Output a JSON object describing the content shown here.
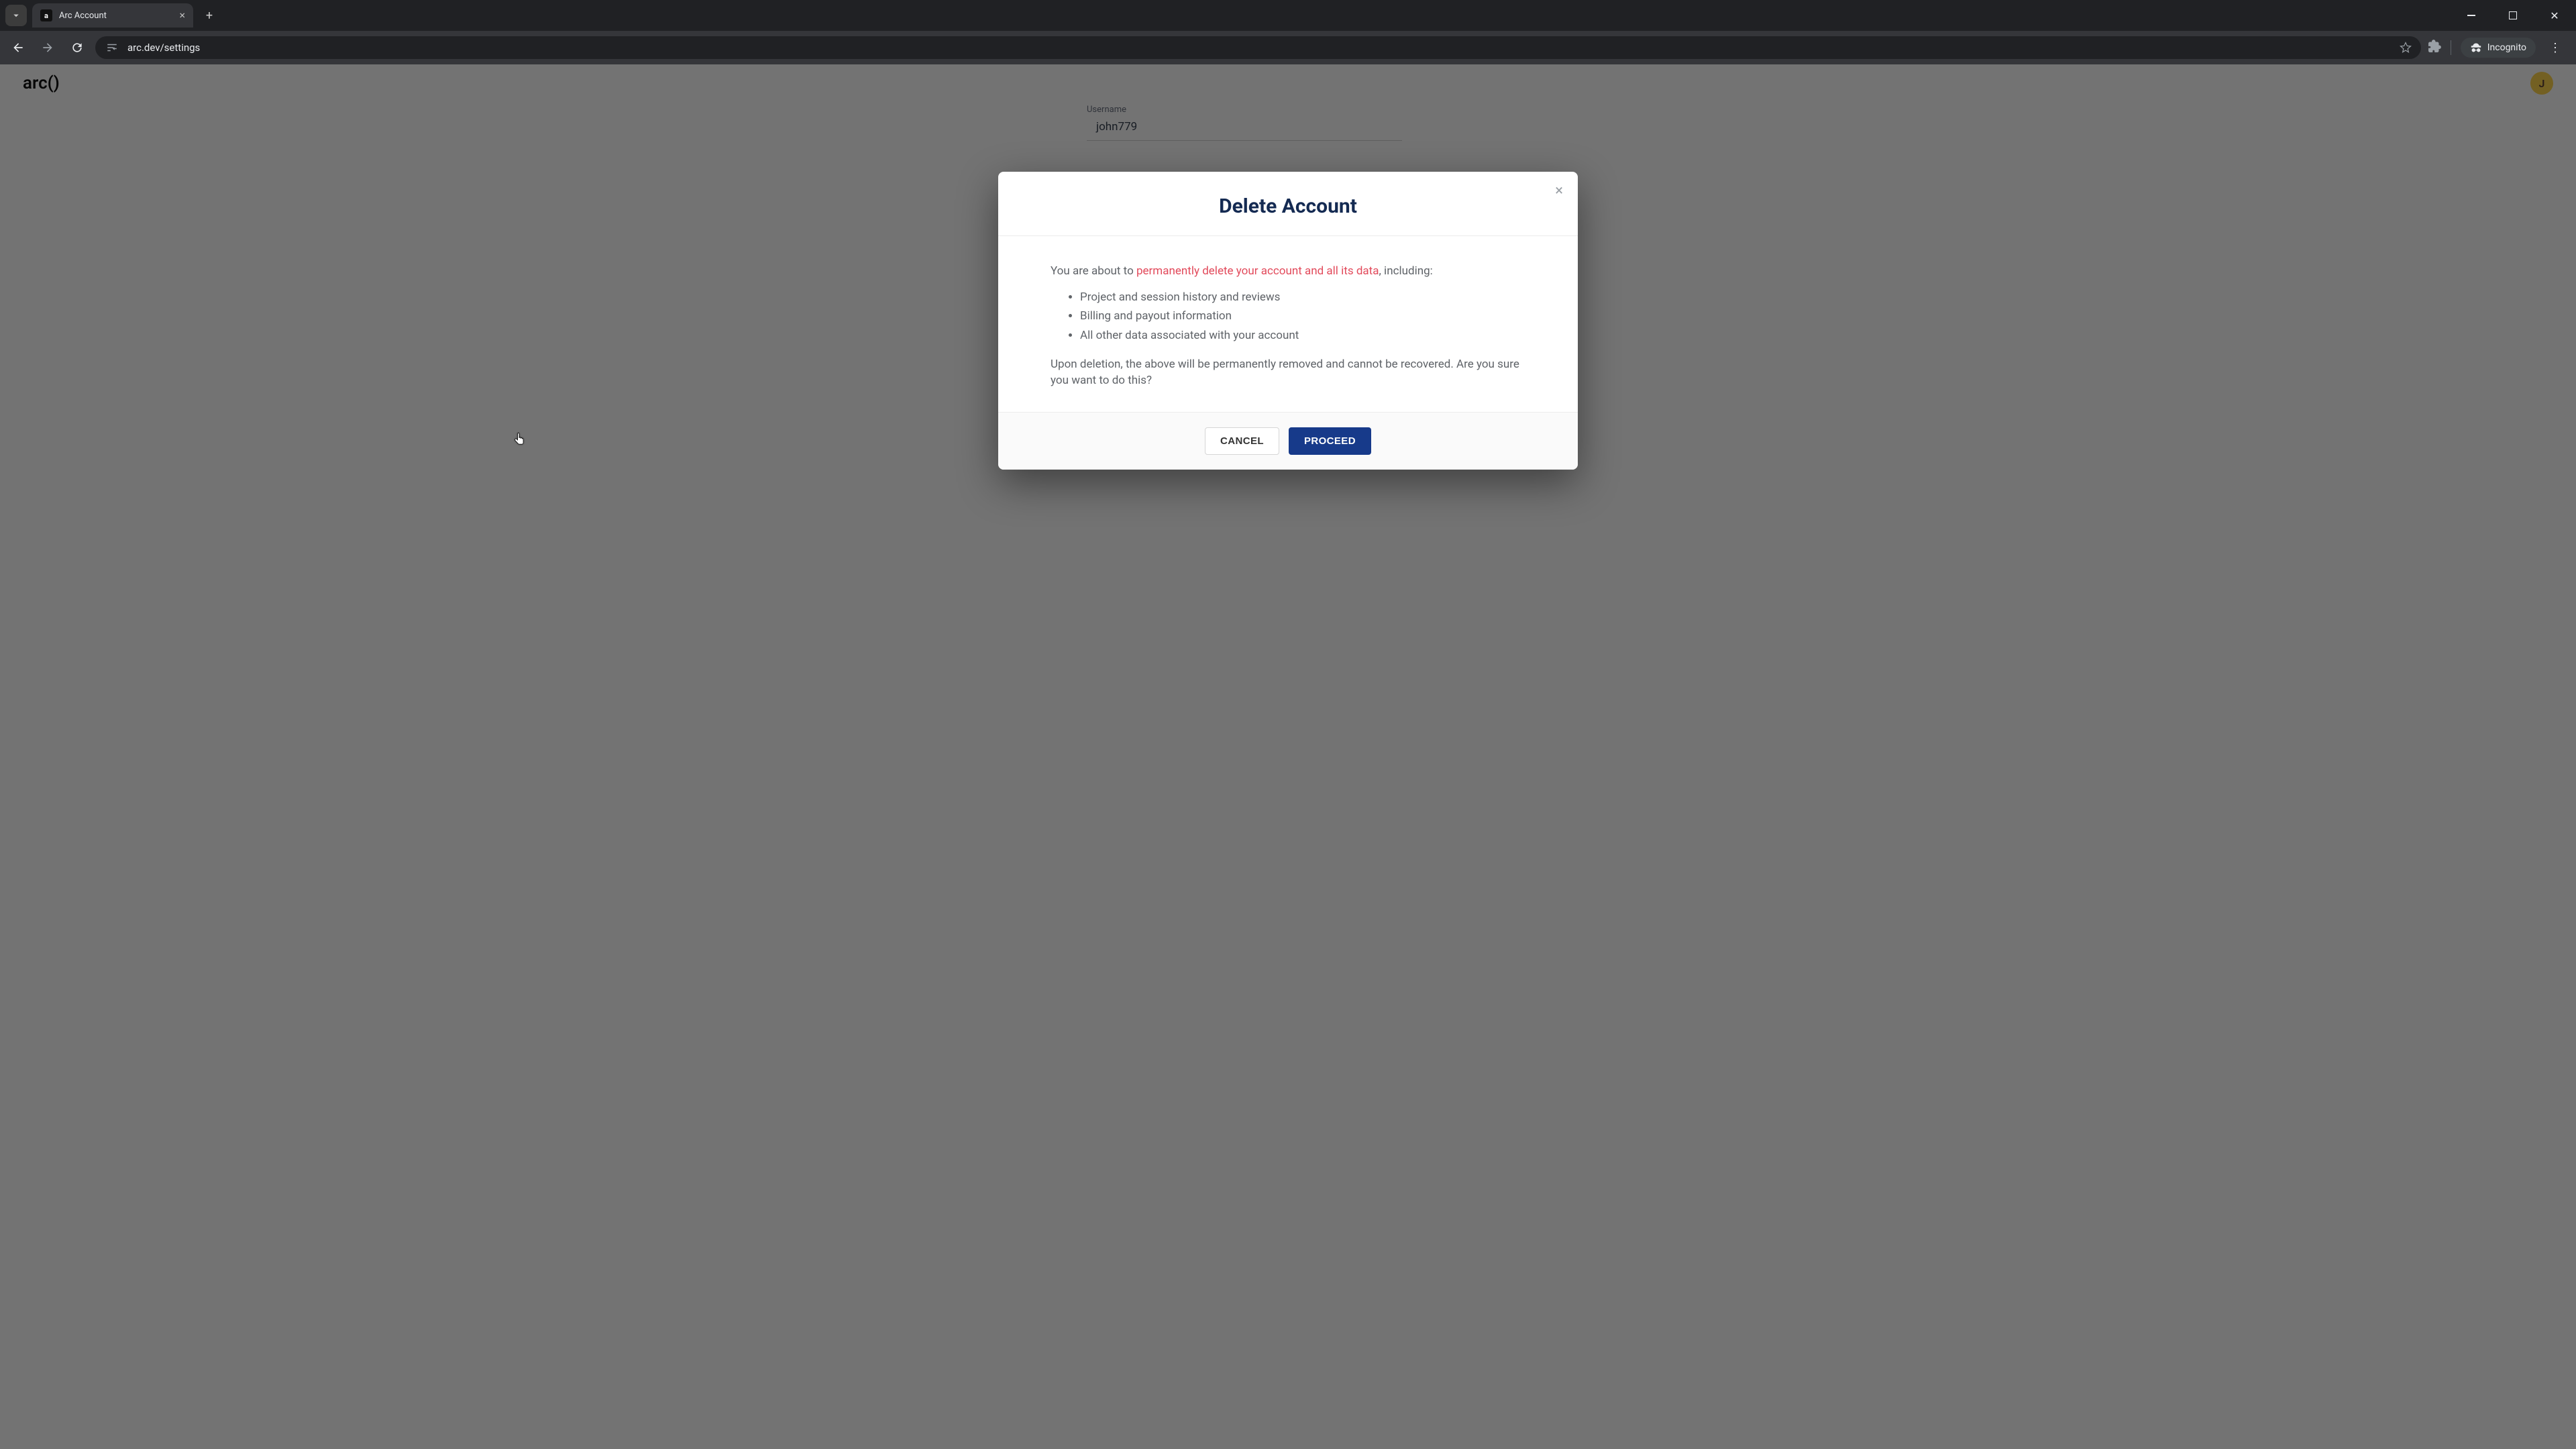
{
  "browser": {
    "tab_title": "Arc Account",
    "url": "arc.dev/settings",
    "incognito_label": "Incognito"
  },
  "site": {
    "logo_text": "arc()",
    "avatar_initial": "J",
    "field_username_label": "Username",
    "field_username_value": "john779"
  },
  "modal": {
    "title": "Delete Account",
    "intro_before": "You are about to ",
    "intro_highlight": "permanently delete your account and all its data",
    "intro_after": ", including:",
    "bullets": [
      "Project and session history and reviews",
      "Billing and payout information",
      "All other data associated with your account"
    ],
    "confirm_text": "Upon deletion, the above will be permanently removed and cannot be recovered. Are you sure you want to do this?",
    "cancel_label": "CANCEL",
    "proceed_label": "PROCEED"
  }
}
